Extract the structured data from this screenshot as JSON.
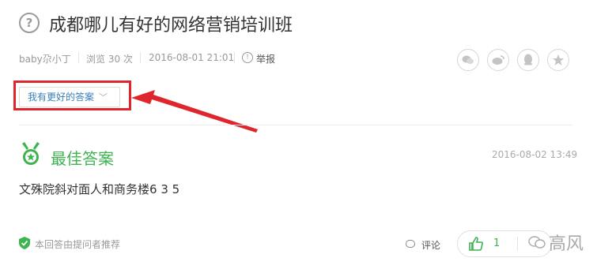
{
  "question": {
    "icon": "question-circle-icon",
    "title": "成都哪儿有好的网络营销培训班"
  },
  "meta": {
    "author": "baby尕小丁",
    "views": "浏览 30 次",
    "date": "2016-08-01 21:01",
    "report": "举报"
  },
  "share_icons": [
    "wechat-icon",
    "weibo-icon",
    "qq-icon",
    "favorite-star-icon"
  ],
  "better_answer_button": "我有更好的答案",
  "annotation_color": "#e0262d",
  "best_answer": {
    "heading": "最佳答案",
    "date": "2016-08-02 13:49",
    "text": "文殊院斜对面人和商务楼6 3 5",
    "accent": "#3db450"
  },
  "footer": {
    "recommend": "本回答由提问者推荐",
    "comment": "评论",
    "like_count": "1"
  },
  "watermark": "高风"
}
